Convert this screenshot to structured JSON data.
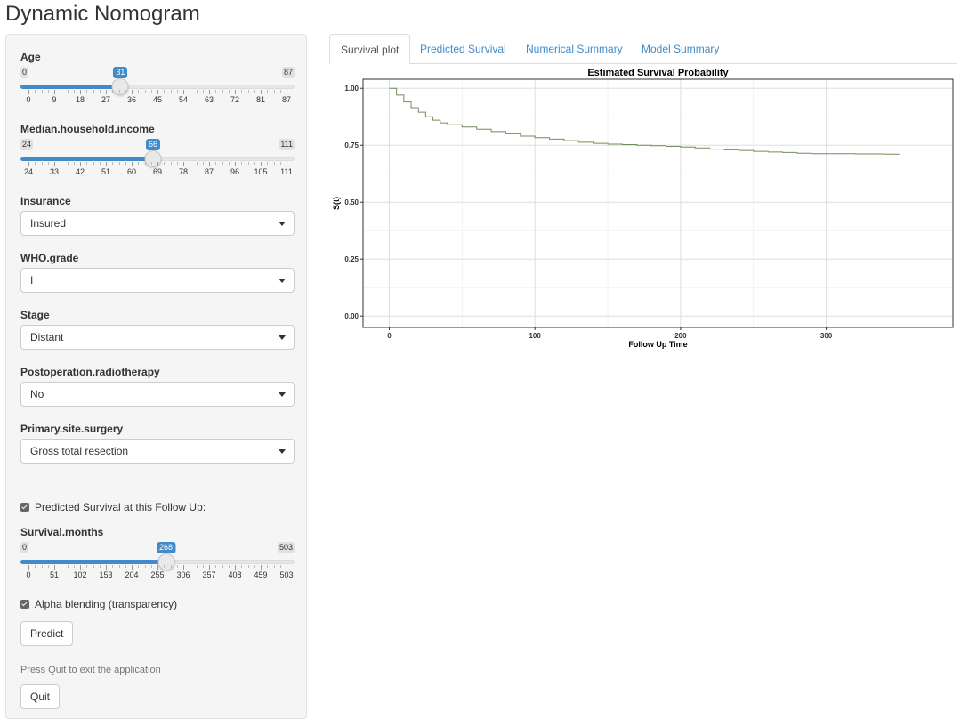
{
  "app": {
    "title": "Dynamic Nomogram"
  },
  "sidebar": {
    "age": {
      "label": "Age",
      "min": 0,
      "max": 87,
      "value": 31,
      "ticks": [
        "0",
        "9",
        "18",
        "27",
        "36",
        "45",
        "54",
        "63",
        "72",
        "81",
        "87"
      ]
    },
    "income": {
      "label": "Median.household.income",
      "min": 24,
      "max": 111,
      "value": 66,
      "ticks": [
        "24",
        "33",
        "42",
        "51",
        "60",
        "69",
        "78",
        "87",
        "96",
        "105",
        "111"
      ]
    },
    "insurance": {
      "label": "Insurance",
      "value": "Insured"
    },
    "who_grade": {
      "label": "WHO.grade",
      "value": "I"
    },
    "stage": {
      "label": "Stage",
      "value": "Distant"
    },
    "radiotherapy": {
      "label": "Postoperation.radiotherapy",
      "value": "No"
    },
    "surgery": {
      "label": "Primary.site.surgery",
      "value": "Gross total resection"
    },
    "predicted_check": {
      "label": "Predicted Survival at this Follow Up:",
      "checked": true
    },
    "survival_months": {
      "label": "Survival.months",
      "min": 0,
      "max": 503,
      "value": 268,
      "ticks": [
        "0",
        "51",
        "102",
        "153",
        "204",
        "255",
        "306",
        "357",
        "408",
        "459",
        "503"
      ]
    },
    "alpha_check": {
      "label": "Alpha blending (transparency)",
      "checked": true
    },
    "predict_button": "Predict",
    "quit_hint": "Press Quit to exit the application",
    "quit_button": "Quit"
  },
  "tabs": [
    {
      "label": "Survival plot",
      "active": true
    },
    {
      "label": "Predicted Survival",
      "active": false
    },
    {
      "label": "Numerical Summary",
      "active": false
    },
    {
      "label": "Model Summary",
      "active": false
    }
  ],
  "chart_data": {
    "type": "line",
    "title": "Estimated Survival Probability",
    "xlabel": "Follow Up Time",
    "ylabel": "S(t)",
    "xlim": [
      -18,
      387
    ],
    "ylim": [
      -0.05,
      1.04
    ],
    "xticks": [
      0,
      100,
      200,
      300
    ],
    "yticks": [
      0.0,
      0.25,
      0.5,
      0.75,
      1.0
    ],
    "ytick_labels": [
      "0.00",
      "0.25",
      "0.50",
      "0.75",
      "1.00"
    ],
    "grid": true,
    "line_color": "#5a7a3a",
    "series": [
      {
        "x": [
          0,
          5,
          10,
          15,
          20,
          25,
          30,
          35,
          40,
          50,
          60,
          70,
          80,
          90,
          100,
          110,
          120,
          130,
          140,
          150,
          160,
          170,
          180,
          190,
          200,
          210,
          220,
          230,
          240,
          250,
          260,
          270,
          280,
          290,
          300,
          310,
          320,
          330,
          340,
          350
        ],
        "y": [
          1.0,
          0.97,
          0.94,
          0.915,
          0.895,
          0.875,
          0.86,
          0.848,
          0.84,
          0.83,
          0.82,
          0.81,
          0.8,
          0.79,
          0.783,
          0.777,
          0.77,
          0.763,
          0.758,
          0.755,
          0.753,
          0.75,
          0.748,
          0.745,
          0.742,
          0.738,
          0.733,
          0.73,
          0.727,
          0.723,
          0.72,
          0.718,
          0.715,
          0.713,
          0.713,
          0.713,
          0.712,
          0.712,
          0.711,
          0.71
        ]
      }
    ]
  }
}
